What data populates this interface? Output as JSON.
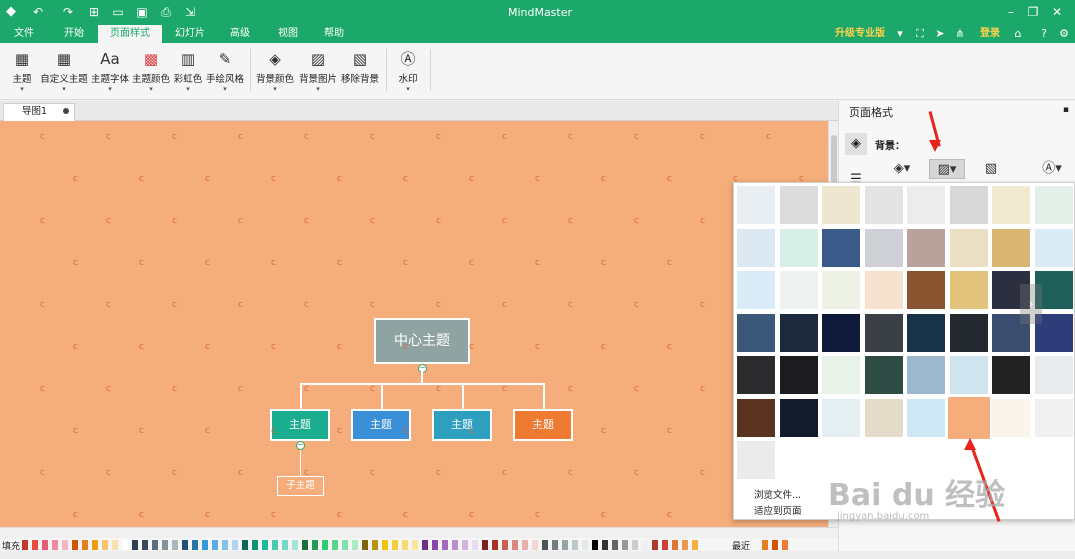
{
  "app": {
    "title": "MindMaster"
  },
  "menu": {
    "items": [
      "文件",
      "开始",
      "页面样式",
      "幻灯片",
      "高级",
      "视图",
      "帮助"
    ],
    "active": "页面样式",
    "upgrade_label": "升级专业版",
    "login_label": "登录"
  },
  "ribbon": {
    "buttons": [
      {
        "label": "主题",
        "icon": "grid-icon"
      },
      {
        "label": "自定义主题",
        "icon": "grid-icon"
      },
      {
        "label": "主题字体",
        "icon": "font-icon"
      },
      {
        "label": "主题颜色",
        "icon": "color-grid-icon"
      },
      {
        "label": "彩虹色",
        "icon": "rainbow-icon"
      },
      {
        "label": "手绘风格",
        "icon": "pen-icon"
      },
      {
        "label": "背景颜色",
        "icon": "paint-bucket-icon"
      },
      {
        "label": "背景图片",
        "icon": "image-icon"
      },
      {
        "label": "移除背景",
        "icon": "remove-image-icon"
      },
      {
        "label": "水印",
        "icon": "watermark-icon"
      }
    ],
    "icon_glyph": "▦",
    "font_glyph": "Aa"
  },
  "document": {
    "tab_label": "导图1"
  },
  "canvas": {
    "background_color": "#f4ad7b",
    "central_topic": "中心主题",
    "main_topics": [
      {
        "label": "主题",
        "color": "#1aad8f"
      },
      {
        "label": "主题",
        "color": "#3a8fd6"
      },
      {
        "label": "主题",
        "color": "#2f9fbf"
      },
      {
        "label": "主题",
        "color": "#ef7a31"
      }
    ],
    "subtopic": "子主题"
  },
  "panel": {
    "title": "页面格式",
    "background_label": "背景："
  },
  "popup": {
    "menu_items": [
      "浏览文件...",
      "适应到页面"
    ],
    "selected_tile_color": "#f4ad7b"
  },
  "palette": {
    "fill_label": "填充",
    "recent_label": "最近"
  }
}
